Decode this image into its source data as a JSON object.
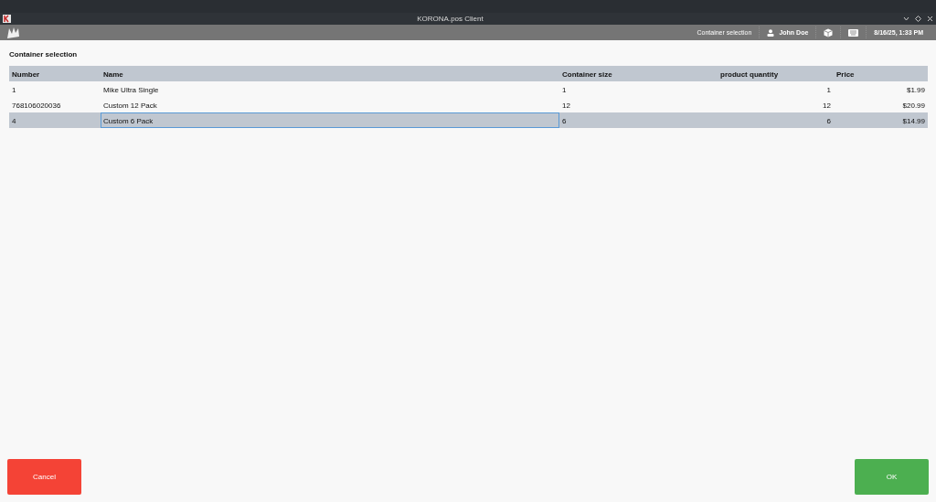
{
  "window": {
    "title": "KORONA.pos Client"
  },
  "toolbar": {
    "screen": "Container selection",
    "user": "John Doe",
    "datetime": "8/16/25, 1:33 PM"
  },
  "heading": "Container selection",
  "table": {
    "columns": [
      "Number",
      "Name",
      "Container size",
      "product quantity",
      "Price"
    ],
    "rows": [
      {
        "cells": [
          "1",
          "Mike Ultra Single",
          "1",
          "1",
          "$1.99"
        ],
        "selected": false,
        "focused": false
      },
      {
        "cells": [
          "768106020036",
          "Custom 12 Pack",
          "12",
          "12",
          "$20.99"
        ],
        "selected": false,
        "focused": false
      },
      {
        "cells": [
          "4",
          "Custom 6 Pack",
          "6",
          "6",
          "$14.99"
        ],
        "selected": true,
        "focused": true
      }
    ]
  },
  "buttons": [
    {
      "label": "Cancel",
      "kind": "cancel"
    },
    {
      "label": "OK",
      "kind": "ok"
    }
  ]
}
